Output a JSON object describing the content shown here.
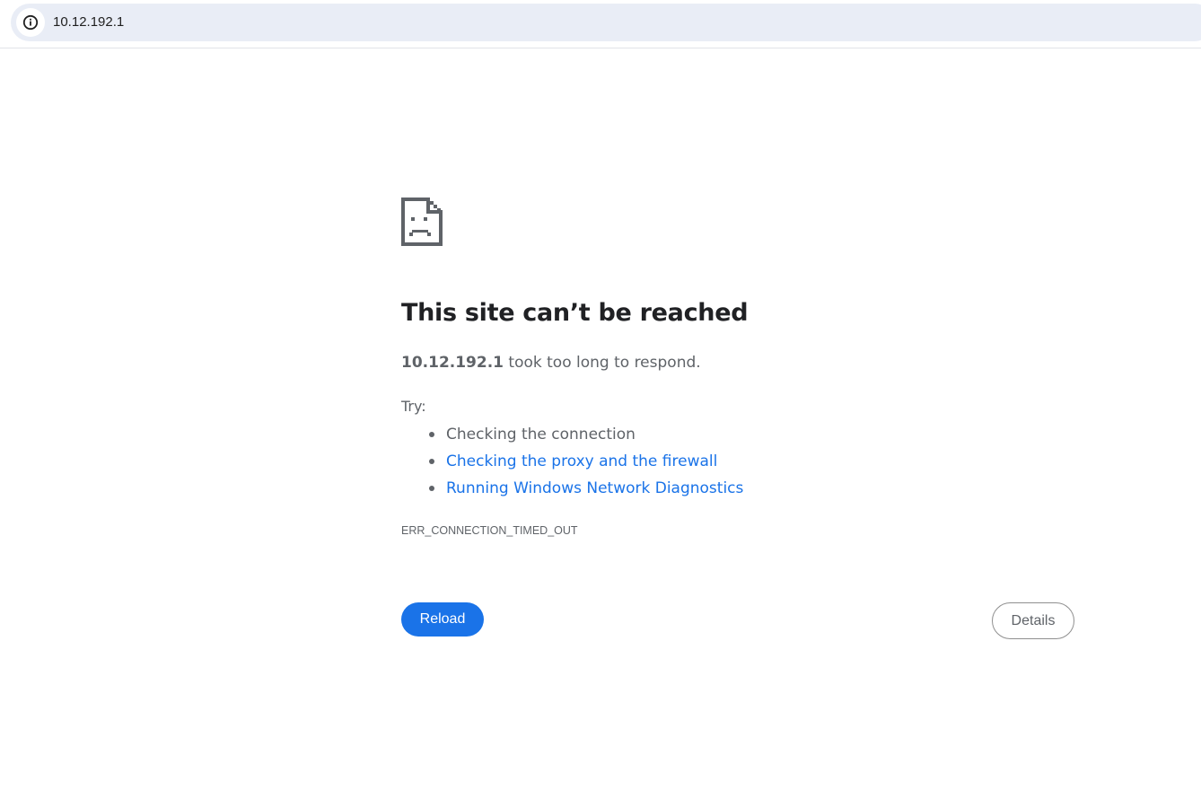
{
  "browser": {
    "url": "10.12.192.1",
    "site_info_icon": "info-icon"
  },
  "error_page": {
    "icon": "sad-page-icon",
    "title": "This site can’t be reached",
    "summary_host": "10.12.192.1",
    "summary_rest": " took too long to respond.",
    "try_label": "Try:",
    "suggestions": [
      {
        "label": "Checking the connection",
        "is_link": false
      },
      {
        "label": "Checking the proxy and the firewall",
        "is_link": true
      },
      {
        "label": "Running Windows Network Diagnostics",
        "is_link": true
      }
    ],
    "error_code": "ERR_CONNECTION_TIMED_OUT",
    "reload_label": "Reload",
    "details_label": "Details"
  },
  "colors": {
    "accent": "#1a73e8",
    "text_primary": "#202124",
    "text_secondary": "#5f6368",
    "omnibox_bg": "#e9edf6"
  }
}
